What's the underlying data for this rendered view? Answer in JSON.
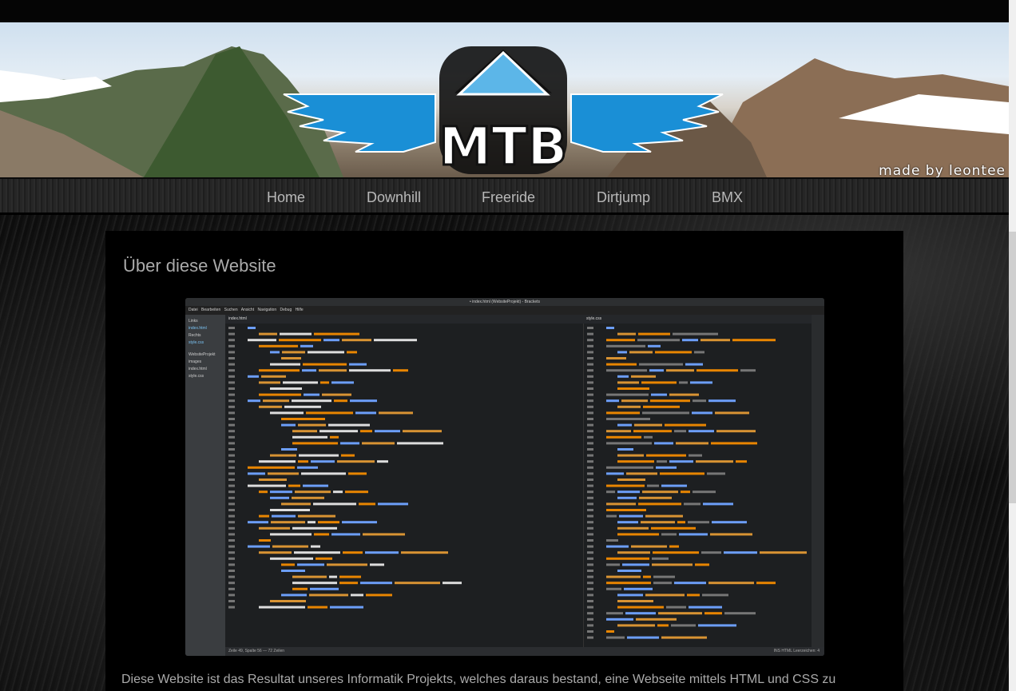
{
  "header": {
    "logo_text": "MTB",
    "signature": "made by leontee"
  },
  "nav": {
    "items": [
      {
        "label": "Home"
      },
      {
        "label": "Downhill"
      },
      {
        "label": "Freeride"
      },
      {
        "label": "Dirtjump"
      },
      {
        "label": "BMX"
      }
    ]
  },
  "main": {
    "title": "Über diese Website",
    "intro": "Diese Website ist das Resultat unseres Informatik Projekts, welches daraus bestand, eine Webseite mittels HTML und CSS zu"
  },
  "screenshot": {
    "window_title": "• index.html (WebsiteProjekt) - Brackets",
    "menu": "Datei  Bearbeiten  Suchen  Ansicht  Navigation  Debug  Hilfe",
    "sidebar": [
      "Links",
      "index.html",
      "Rechts",
      "style.css",
      "WebsiteProjekt",
      "images",
      "index.html",
      "style.css"
    ],
    "tab_left": "index.html",
    "tab_right": "style.css",
    "status": "Zeile 49, Spalte 56 — 72 Zeilen",
    "status_right": "INS    HTML    Leerzeichen: 4",
    "colors": {
      "tag": "#6c9ef8",
      "attr": "#d89333",
      "string": "#e88501",
      "text": "#dddddd",
      "linenum": "#767676",
      "property": "#d89333",
      "selector": "#6c9ef8",
      "comment": "#767676"
    }
  }
}
